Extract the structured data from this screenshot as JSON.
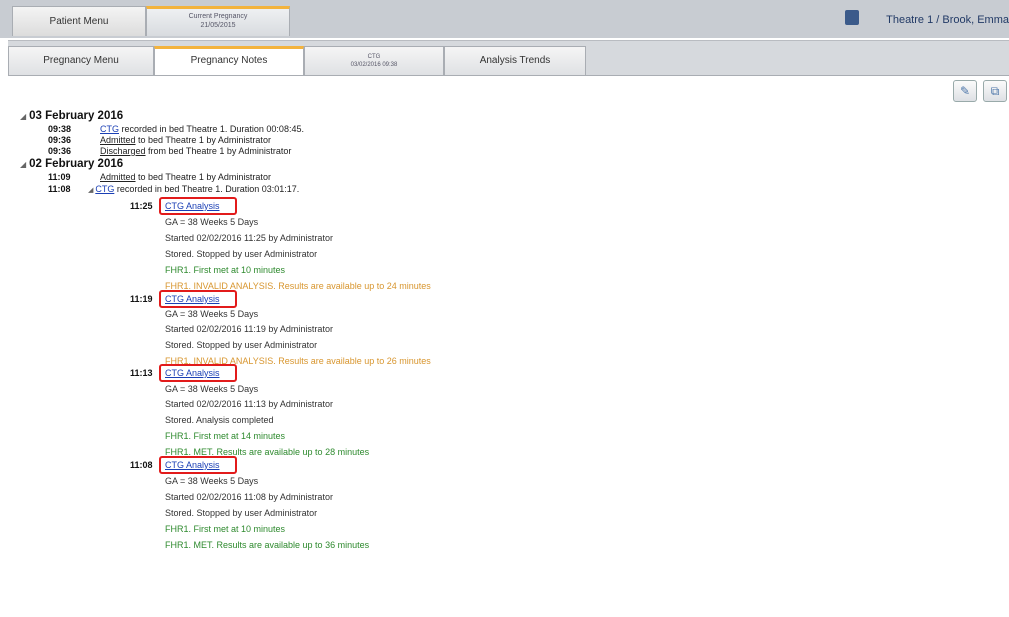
{
  "top_tabs": [
    {
      "label": "Patient Menu"
    },
    {
      "label": "Current Pregnancy",
      "sub": "21/05/2015"
    }
  ],
  "patient_label": "Theatre 1 / Brook, Emma",
  "sub_tabs": [
    {
      "label": "Pregnancy Menu"
    },
    {
      "label": "Pregnancy Notes"
    },
    {
      "label": "CTG",
      "sub": "03/02/2016 09:38"
    },
    {
      "label": "Analysis Trends"
    }
  ],
  "days": [
    {
      "date": "03 February 2016",
      "events": [
        {
          "time": "09:38",
          "link": "CTG",
          "text": " recorded in bed Theatre 1.  Duration 00:08:45."
        },
        {
          "time": "09:36",
          "link": "Admitted",
          "text": " to bed Theatre 1 by Administrator"
        },
        {
          "time": "09:36",
          "link": "Discharged",
          "text": " from bed Theatre 1 by Administrator"
        }
      ]
    },
    {
      "date": "02 February 2016",
      "events": [
        {
          "time": "11:09",
          "link": "Admitted",
          "text": " to bed Theatre 1 by Administrator"
        },
        {
          "time": "11:08",
          "link": "CTG",
          "text": " recorded in bed Theatre 1.  Duration 03:01:17."
        }
      ]
    }
  ],
  "analyses": [
    {
      "time": "11:25",
      "link": "CTG Analysis",
      "lines": [
        {
          "text": "GA = 38 Weeks 5 Days",
          "style": "normal"
        },
        {
          "text": "Started 02/02/2016 11:25 by Administrator",
          "style": "normal"
        },
        {
          "text": "Stored. Stopped by user Administrator",
          "style": "normal"
        },
        {
          "text": "FHR1. First met at 10 minutes",
          "style": "green"
        },
        {
          "text": "FHR1. INVALID ANALYSIS. Results are available up to 24 minutes",
          "style": "orange"
        }
      ]
    },
    {
      "time": "11:19",
      "link": "CTG Analysis",
      "lines": [
        {
          "text": "GA = 38 Weeks 5 Days",
          "style": "normal"
        },
        {
          "text": "Started 02/02/2016 11:19 by Administrator",
          "style": "normal"
        },
        {
          "text": "Stored. Stopped by user Administrator",
          "style": "normal"
        },
        {
          "text": "FHR1. INVALID ANALYSIS. Results are available up to 26 minutes",
          "style": "orange"
        }
      ]
    },
    {
      "time": "11:13",
      "link": "CTG Analysis",
      "lines": [
        {
          "text": "GA = 38 Weeks 5 Days",
          "style": "normal"
        },
        {
          "text": "Started 02/02/2016 11:13 by Administrator",
          "style": "normal"
        },
        {
          "text": "Stored. Analysis completed",
          "style": "normal"
        },
        {
          "text": "FHR1. First met at 14 minutes",
          "style": "green"
        },
        {
          "text": "FHR1. MET. Results are available up to 28 minutes",
          "style": "green"
        }
      ]
    },
    {
      "time": "11:08",
      "link": "CTG Analysis",
      "lines": [
        {
          "text": "GA = 38 Weeks 5 Days",
          "style": "normal"
        },
        {
          "text": "Started 02/02/2016 11:08 by Administrator",
          "style": "normal"
        },
        {
          "text": "Stored. Stopped by user Administrator",
          "style": "normal"
        },
        {
          "text": "FHR1. First met at 10 minutes",
          "style": "green"
        },
        {
          "text": "FHR1. MET. Results are available up to 36 minutes",
          "style": "green"
        }
      ]
    }
  ]
}
